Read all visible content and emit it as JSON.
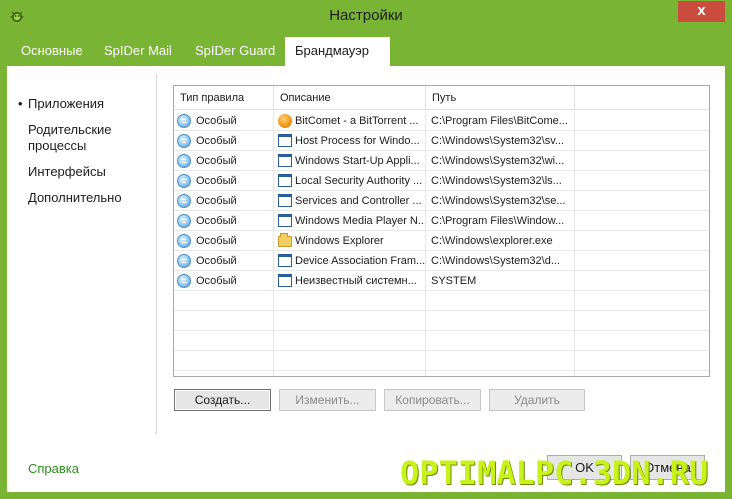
{
  "window": {
    "title": "Настройки",
    "close_glyph": "x",
    "icon": "spider-icon"
  },
  "tabs": [
    {
      "label": "Основные",
      "active": false
    },
    {
      "label": "SpIDer Mail",
      "active": false
    },
    {
      "label": "SpIDer Guard",
      "active": false
    },
    {
      "label": "Брандмауэр",
      "active": true
    }
  ],
  "sidebar": {
    "bullet": "•",
    "items": [
      {
        "label": "Приложения",
        "selected": true
      },
      {
        "label": "Родительские процессы",
        "selected": false
      },
      {
        "label": "Интерфейсы",
        "selected": false
      },
      {
        "label": "Дополнительно",
        "selected": false
      }
    ]
  },
  "table": {
    "columns": [
      "Тип правила",
      "Описание",
      "Путь",
      ""
    ],
    "rows": [
      {
        "type": "Особый",
        "icon": "bitcomet-icon",
        "description": "BitComet - a BitTorrent ...",
        "path": "C:\\Program Files\\BitCome..."
      },
      {
        "type": "Особый",
        "icon": "window-icon",
        "description": "Host Process for Windo...",
        "path": "C:\\Windows\\System32\\sv..."
      },
      {
        "type": "Особый",
        "icon": "window-icon",
        "description": "Windows Start-Up Appli...",
        "path": "C:\\Windows\\System32\\wi..."
      },
      {
        "type": "Особый",
        "icon": "window-icon",
        "description": "Local Security Authority ...",
        "path": "C:\\Windows\\System32\\ls..."
      },
      {
        "type": "Особый",
        "icon": "window-icon",
        "description": "Services and Controller ...",
        "path": "C:\\Windows\\System32\\se..."
      },
      {
        "type": "Особый",
        "icon": "window-icon",
        "description": "Windows Media Player N...",
        "path": "C:\\Program Files\\Window..."
      },
      {
        "type": "Особый",
        "icon": "folder-explorer-icon",
        "description": "Windows Explorer",
        "path": "C:\\Windows\\explorer.exe"
      },
      {
        "type": "Особый",
        "icon": "window-icon",
        "description": "Device Association Fram...",
        "path": "C:\\Windows\\System32\\d..."
      },
      {
        "type": "Особый",
        "icon": "window-icon",
        "description": "Неизвестный системн...",
        "path": "SYSTEM"
      }
    ],
    "empty_rows": 5
  },
  "buttons": {
    "create": "Создать...",
    "edit": "Изменить...",
    "copy": "Копировать...",
    "delete": "Удалить"
  },
  "footer": {
    "help": "Справка",
    "ok": "OK",
    "cancel": "Отмена"
  },
  "watermark": "OPTIMALPC.3DN.RU",
  "colors": {
    "accent": "#7ab434",
    "help_link": "#2f8f1f",
    "close": "#c94c3f"
  }
}
